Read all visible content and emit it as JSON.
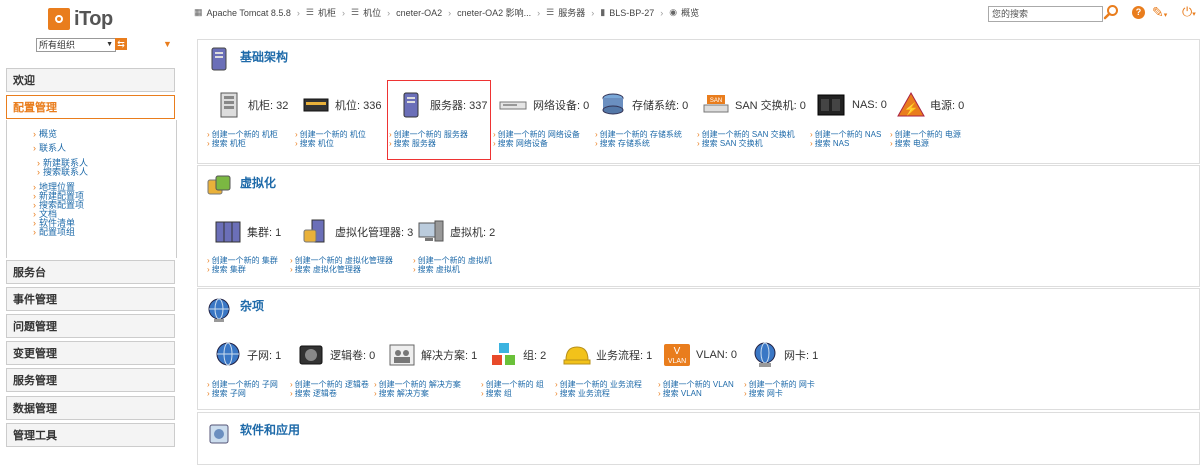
{
  "app": {
    "logo_text": "iTop"
  },
  "left": {
    "org_select": "所有组织",
    "menus": [
      {
        "label": "欢迎",
        "active": false
      },
      {
        "label": "配置管理",
        "active": true
      }
    ],
    "config_items": [
      {
        "label": "概览"
      },
      {
        "label": "联系人"
      },
      {
        "label": "新建联系人"
      },
      {
        "label": "搜索联系人"
      },
      {
        "label": "地理位置"
      },
      {
        "label": "新建配置项"
      },
      {
        "label": "搜索配置项"
      },
      {
        "label": "文档"
      },
      {
        "label": "软件清单"
      },
      {
        "label": "配置项组"
      }
    ],
    "bottom_menus": [
      "服务台",
      "事件管理",
      "问题管理",
      "变更管理",
      "服务管理",
      "数据管理",
      "管理工具"
    ]
  },
  "breadcrumb": [
    "Apache Tomcat 8.5.8",
    "机柜",
    "机位",
    "cneter-OA2",
    "cneter-OA2 影响...",
    "服务器",
    "BLS-BP-27",
    "概览"
  ],
  "search": {
    "placeholder": "您的搜索"
  },
  "sections": {
    "infra": {
      "title": "基础架构",
      "items": [
        {
          "label": "机柜: 32",
          "create": "创建一个新的 机柜",
          "search": "搜索 机柜"
        },
        {
          "label": "机位: 336",
          "create": "创建一个新的 机位",
          "search": "搜索 机位"
        },
        {
          "label": "服务器: 337",
          "create": "创建一个新的 服务器",
          "search": "搜索 服务器"
        },
        {
          "label": "网络设备: 0",
          "create": "创建一个新的 网络设备",
          "search": "搜索 网络设备"
        },
        {
          "label": "存储系统: 0",
          "create": "创建一个新的 存储系统",
          "search": "搜索 存储系统"
        },
        {
          "label": "SAN 交换机: 0",
          "create": "创建一个新的 SAN 交换机",
          "search": "搜索 SAN 交换机"
        },
        {
          "label": "NAS: 0",
          "create": "创建一个新的 NAS",
          "search": "搜索 NAS"
        },
        {
          "label": "电源: 0",
          "create": "创建一个新的 电源",
          "search": "搜索 电源"
        }
      ]
    },
    "virt": {
      "title": "虚拟化",
      "items": [
        {
          "label": "集群: 1",
          "create": "创建一个新的 集群",
          "search": "搜索 集群"
        },
        {
          "label": "虚拟化管理器: 3",
          "create": "创建一个新的 虚拟化管理器",
          "search": "搜索 虚拟化管理器"
        },
        {
          "label": "虚拟机: 2",
          "create": "创建一个新的 虚拟机",
          "search": "搜索 虚拟机"
        }
      ]
    },
    "misc": {
      "title": "杂项",
      "items": [
        {
          "label": "子网: 1",
          "create": "创建一个新的 子网",
          "search": "搜索 子网"
        },
        {
          "label": "逻辑卷: 0",
          "create": "创建一个新的 逻辑卷",
          "search": "搜索 逻辑卷"
        },
        {
          "label": "解决方案: 1",
          "create": "创建一个新的 解决方案",
          "search": "搜索 解决方案"
        },
        {
          "label": "组: 2",
          "create": "创建一个新的 组",
          "search": "搜索 组"
        },
        {
          "label": "业务流程: 1",
          "create": "创建一个新的 业务流程",
          "search": "搜索 业务流程"
        },
        {
          "label": "VLAN: 0",
          "create": "创建一个新的 VLAN",
          "search": "搜索 VLAN"
        },
        {
          "label": "网卡: 1",
          "create": "创建一个新的 网卡",
          "search": "搜索 网卡"
        }
      ]
    },
    "software": {
      "title": "软件和应用"
    }
  },
  "colors": {
    "accent": "#e97d1d",
    "link": "#1e6aa9",
    "highlight": "#e33333"
  }
}
